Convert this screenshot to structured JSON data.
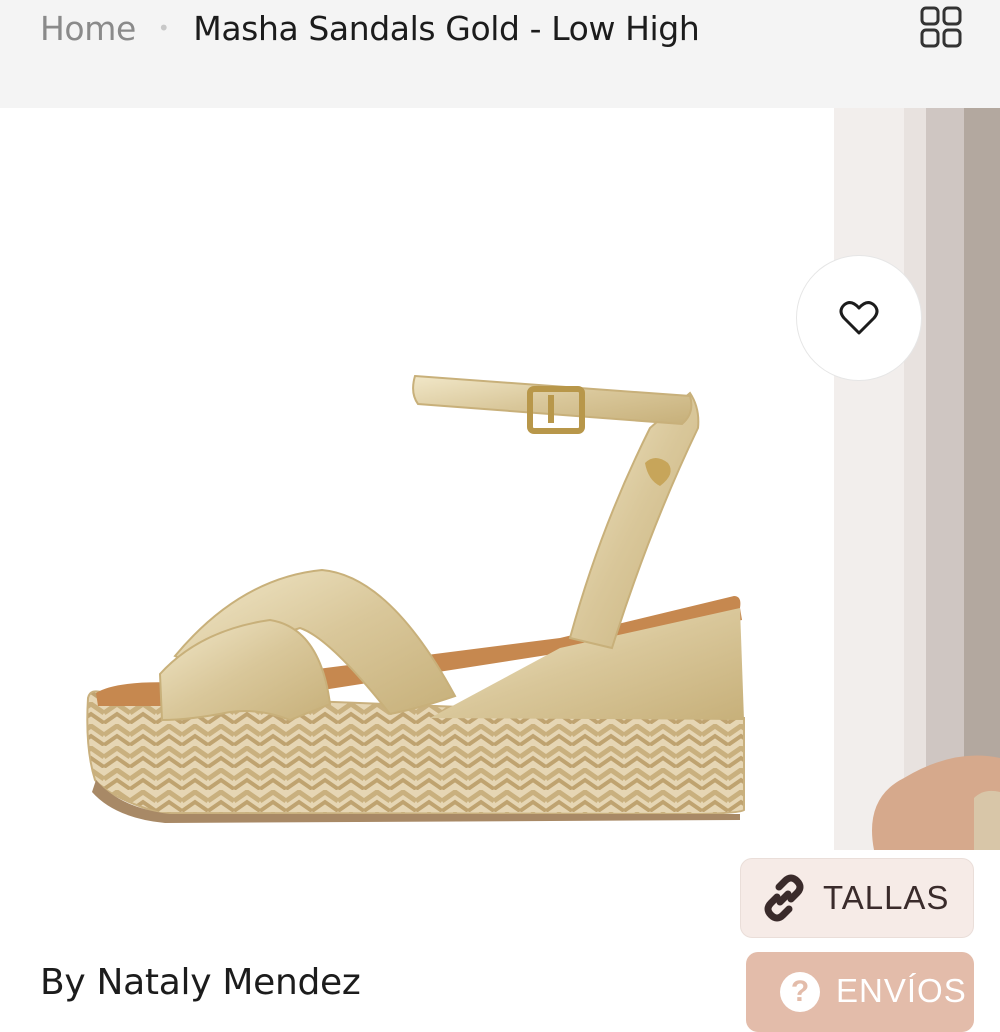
{
  "breadcrumb": {
    "home": "Home",
    "separator": "•",
    "current": "Masha Sandals Gold - Low High"
  },
  "header": {
    "grid_icon": "grid-view-icon"
  },
  "gallery": {
    "main_image_alt": "Masha Sandals Gold - Low High",
    "favorite_icon": "heart-icon"
  },
  "actions": {
    "tallas_label": "TALLAS",
    "tallas_icon": "link-icon",
    "envios_label": "ENVÍOS",
    "envios_icon": "question-icon"
  },
  "product": {
    "byline": "By Nataly Mendez"
  },
  "colors": {
    "tallas_bg": "#f6ebe7",
    "envios_bg": "#e3bcaa",
    "topbar_bg": "#f4f4f4",
    "gold": "#d9c79a"
  }
}
